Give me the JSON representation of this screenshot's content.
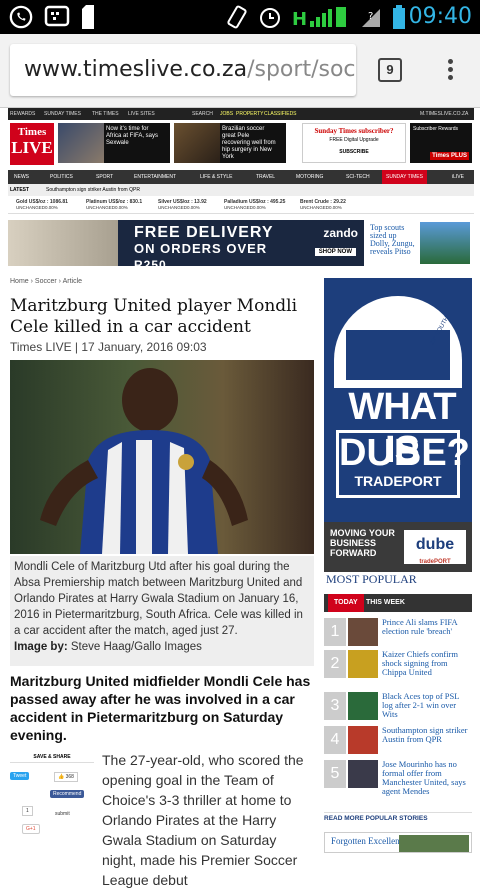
{
  "statusbar": {
    "time": "09:40",
    "network": "H"
  },
  "browser": {
    "url_host": "www.timeslive.co.za",
    "url_path": "/sport/soc",
    "tab_count": "9"
  },
  "site": {
    "toplinks": [
      "REWARDS",
      "SUNDAY TIMES",
      "THE TIMES",
      "LIVE SITES",
      "SEARCH",
      "JOBS",
      "PROPERTY",
      "CLASSIFIEDS",
      "M.TIMESLIVE.CO.ZA"
    ],
    "logo_top": "Times",
    "logo_bottom": "LIVE",
    "promo1": "Now it's time for Africa at FIFA, says Sexwale",
    "promo2": "Brazilian soccer great Pele recovering well from hip surgery in New York",
    "sunday": {
      "title": "Sunday Times subscriber?",
      "subtitle": "FREE Digital Upgrade",
      "button": "SUBSCRIBE"
    },
    "subrewards": {
      "title": "Subscriber Rewards",
      "badge": "Times PLUS"
    },
    "nav": [
      "NEWS",
      "POLITICS",
      "SPORT",
      "ENTERTAINMENT",
      "LIFE & STYLE",
      "TRAVEL",
      "MOTORING",
      "SCI-TECH",
      "SUNDAY TIMES",
      "iLIVE"
    ],
    "latest_label": "LATEST",
    "latest_text": "Southampton sign striker Austin from QPR",
    "tickers": [
      {
        "name": "Gold US$/oz : 1086.81",
        "change": "UNCHANGED0.00%"
      },
      {
        "name": "Platinum US$/oz : 830.1",
        "change": "UNCHANGED0.00%"
      },
      {
        "name": "Silver US$/oz : 13.92",
        "change": "UNCHANGED0.00%"
      },
      {
        "name": "Palladium US$/oz : 495.25",
        "change": "UNCHANGED0.00%"
      },
      {
        "name": "Brent Crude : 29.22",
        "change": "UNCHANGED0.00%"
      }
    ]
  },
  "ad": {
    "line1": "FREE DELIVERY",
    "line2": "ON ORDERS OVER",
    "line3": "R250",
    "brand": "zando",
    "cta": "SHOP NOW"
  },
  "scout": "Top scouts sized up Dolly, Zungu, reveals Pitso",
  "article": {
    "breadcrumbs": [
      "Home",
      "Soccer",
      "Article"
    ],
    "headline": "Maritzburg United player Mondli Cele killed in a car accident",
    "byline": "Times LIVE | 17 January, 2016 09:03",
    "caption": "Mondli Cele of Maritzburg Utd after his goal during the Absa Premiership match between Maritzburg United and Orlando Pirates at Harry Gwala Stadium on January 16, 2016 in Pietermaritzburg, South Africa. Cele was killed in a car accident after the match, aged just 27.",
    "image_by_label": "Image by:",
    "image_by": "Steve Haag/Gallo Images",
    "lead": "Maritzburg United midfielder Mondli Cele has passed away after he was involved in a car accident in Pietermaritzburg on Saturday evening.",
    "body": "The 27-year-old, who scored the opening goal in the Team of Choice's 3-3 thriller at home to Orlando Pirates at the Harry Gwala Stadium on Saturday night, made his Premier Soccer League debut"
  },
  "share": {
    "title": "SAVE & SHARE",
    "tweet": "Tweet",
    "like_count": "368",
    "recommend": "Recommend",
    "gplus_count": "1",
    "submit": "submit",
    "gplus": "G+1"
  },
  "dube_ad": {
    "line1": "WHAT IS",
    "line2": "DUBE?",
    "line3": "TRADEPORT",
    "footer": "MOVING YOUR BUSINESS FORWARD",
    "logo": "dube",
    "logo_sub": "tradePORT",
    "bldg_label": "29° SOUTH"
  },
  "most_popular": {
    "title": "MOST POPULAR",
    "tabs": [
      "TODAY",
      "THIS WEEK"
    ],
    "items": [
      {
        "num": "1",
        "text": "Prince Ali slams FIFA election rule 'breach'"
      },
      {
        "num": "2",
        "text": "Kaizer Chiefs confirm shock signing from Chippa United"
      },
      {
        "num": "3",
        "text": "Black Aces top of PSL log after 2-1 win over Wits"
      },
      {
        "num": "4",
        "text": "Southampton sign striker Austin from QPR"
      },
      {
        "num": "5",
        "text": "Jose Mourinho has no formal offer from Manchester United, says agent Mendes"
      }
    ],
    "read_more": "READ MORE POPULAR STORIES"
  },
  "forgotten": "Forgotten Excellent",
  "colors": {
    "brand_red": "#d0021b",
    "dube_blue": "#1d3e7c",
    "link_blue": "#1a5aa8",
    "time_blue": "#33b5e5"
  }
}
